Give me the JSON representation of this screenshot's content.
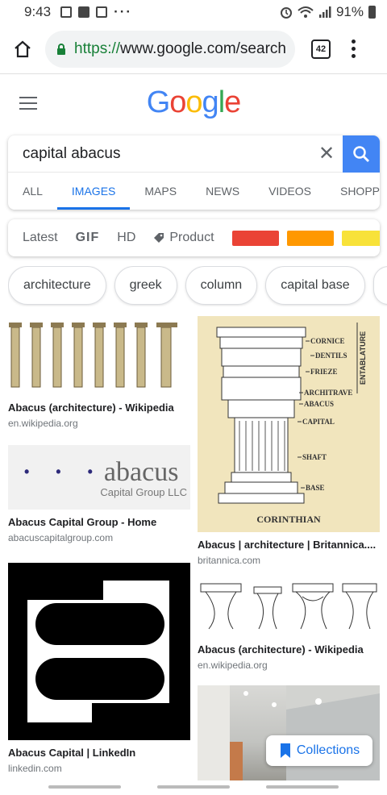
{
  "status": {
    "time": "9:43",
    "dots": "···",
    "battery": "91%"
  },
  "browser": {
    "url_scheme": "https://",
    "url_rest": "www.google.com/search",
    "tab_count": "42"
  },
  "google": {
    "logo_letters": [
      "G",
      "o",
      "o",
      "g",
      "l",
      "e"
    ],
    "logo_colors": [
      "#4285f4",
      "#ea4335",
      "#fbbc05",
      "#4285f4",
      "#34a853",
      "#ea4335"
    ]
  },
  "search": {
    "query": "capital abacus",
    "clear_symbol": "✕"
  },
  "tabs": [
    "ALL",
    "IMAGES",
    "MAPS",
    "NEWS",
    "VIDEOS",
    "SHOPPING"
  ],
  "active_tab": "IMAGES",
  "filters": {
    "latest": "Latest",
    "gif": "GIF",
    "hd": "HD",
    "product": "Product",
    "colors": [
      "#ea4335",
      "#ff9800",
      "#f8e239"
    ]
  },
  "chips": [
    "architecture",
    "greek",
    "column",
    "capital base",
    ""
  ],
  "results": [
    {
      "title": "Abacus (architecture) - Wikipedia",
      "source": "en.wikipedia.org"
    },
    {
      "title": "Abacus Capital Group - Home",
      "source": "abacuscapitalgroup.com",
      "logo_word": "abacus",
      "logo_sub": "Capital Group LLC"
    },
    {
      "title": "Abacus Capital | LinkedIn",
      "source": "linkedin.com"
    },
    {
      "title": "Abacus | architecture | Britannica....",
      "source": "britannica.com",
      "diagram_labels": [
        "CORNICE",
        "DENTILS",
        "FRIEZE",
        "ARCHITRAVE",
        "ABACUS",
        "CAPITAL",
        "SHAFT",
        "BASE"
      ],
      "entablature": "ENTABLATURE",
      "caption": "CORINTHIAN"
    },
    {
      "title": "Abacus (architecture) - Wikipedia",
      "source": "en.wikipedia.org"
    }
  ],
  "collections_label": "Collections"
}
